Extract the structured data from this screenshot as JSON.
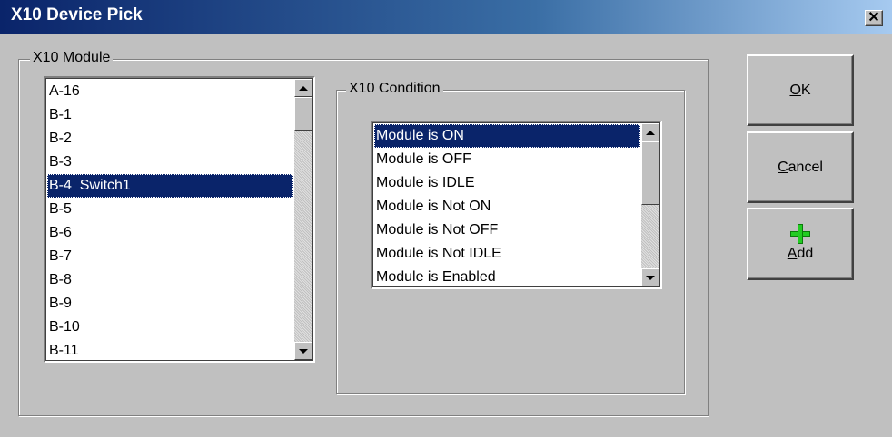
{
  "window": {
    "title": "X10 Device Pick",
    "close_label": "✕"
  },
  "module_group": {
    "label": "X10 Module",
    "items": [
      "A-16",
      "B-1",
      "B-2",
      "B-3",
      "B-4  Switch1",
      "B-5",
      "B-6",
      "B-7",
      "B-8",
      "B-9",
      "B-10",
      "B-11"
    ],
    "selected": "B-4  Switch1"
  },
  "condition_group": {
    "label": "X10 Condition",
    "items": [
      "Module is ON",
      "Module is OFF",
      "Module is IDLE",
      "Module is Not ON",
      "Module is Not OFF",
      "Module is Not IDLE",
      "Module is Enabled"
    ],
    "selected": "Module is ON"
  },
  "buttons": {
    "ok": {
      "prefix": "",
      "mnemonic": "O",
      "suffix": "K"
    },
    "cancel": {
      "prefix": "",
      "mnemonic": "C",
      "suffix": "ancel"
    },
    "add": {
      "prefix": "",
      "mnemonic": "A",
      "suffix": "dd",
      "icon": "plus-icon",
      "icon_color": "#22cc22"
    }
  },
  "colors": {
    "title_bar": "#0a246a",
    "selection": "#0a246a",
    "face": "#c0c0c0"
  }
}
